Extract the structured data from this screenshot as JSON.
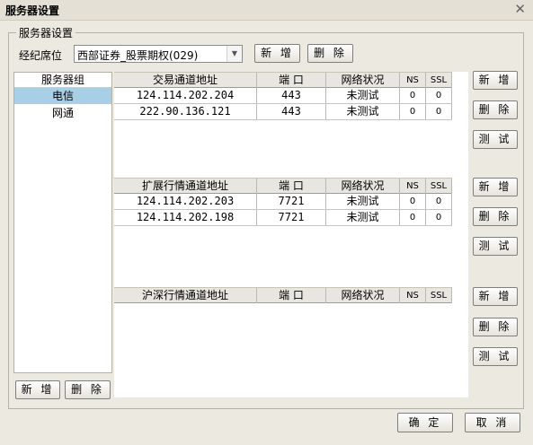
{
  "window": {
    "title": "服务器设置",
    "close_glyph": "✕"
  },
  "group": {
    "legend": "服务器设置"
  },
  "broker": {
    "label": "经纪席位",
    "selected": "西部证券_股票期权(029)",
    "add_label": "新 增",
    "delete_label": "删 除"
  },
  "server_group": {
    "header": "服务器组",
    "items": [
      "电信",
      "网通"
    ],
    "selected_index": 0,
    "add_label": "新 增",
    "delete_label": "删 除"
  },
  "trade": {
    "headers": [
      "交易通道地址",
      "端 口",
      "网络状况",
      "NS",
      "SSL"
    ],
    "rows": [
      [
        "124.114.202.204",
        "443",
        "未测试",
        "0",
        "0"
      ],
      [
        "222.90.136.121",
        "443",
        "未测试",
        "0",
        "0"
      ]
    ],
    "buttons": [
      "新 增",
      "删 除",
      "测 试"
    ]
  },
  "extended": {
    "headers": [
      "扩展行情通道地址",
      "端 口",
      "网络状况",
      "NS",
      "SSL"
    ],
    "rows": [
      [
        "124.114.202.203",
        "7721",
        "未测试",
        "0",
        "0"
      ],
      [
        "124.114.202.198",
        "7721",
        "未测试",
        "0",
        "0"
      ]
    ],
    "buttons": [
      "新 增",
      "删 除",
      "测 试"
    ]
  },
  "hushen": {
    "headers": [
      "沪深行情通道地址",
      "端 口",
      "网络状况",
      "NS",
      "SSL"
    ],
    "rows": [],
    "buttons": [
      "新 增",
      "删 除",
      "测 试"
    ]
  },
  "footer": {
    "ok_label": "确 定",
    "cancel_label": "取 消"
  },
  "colors": {
    "selection": "#a9cfe6",
    "dialog_bg": "#ece9e0"
  }
}
